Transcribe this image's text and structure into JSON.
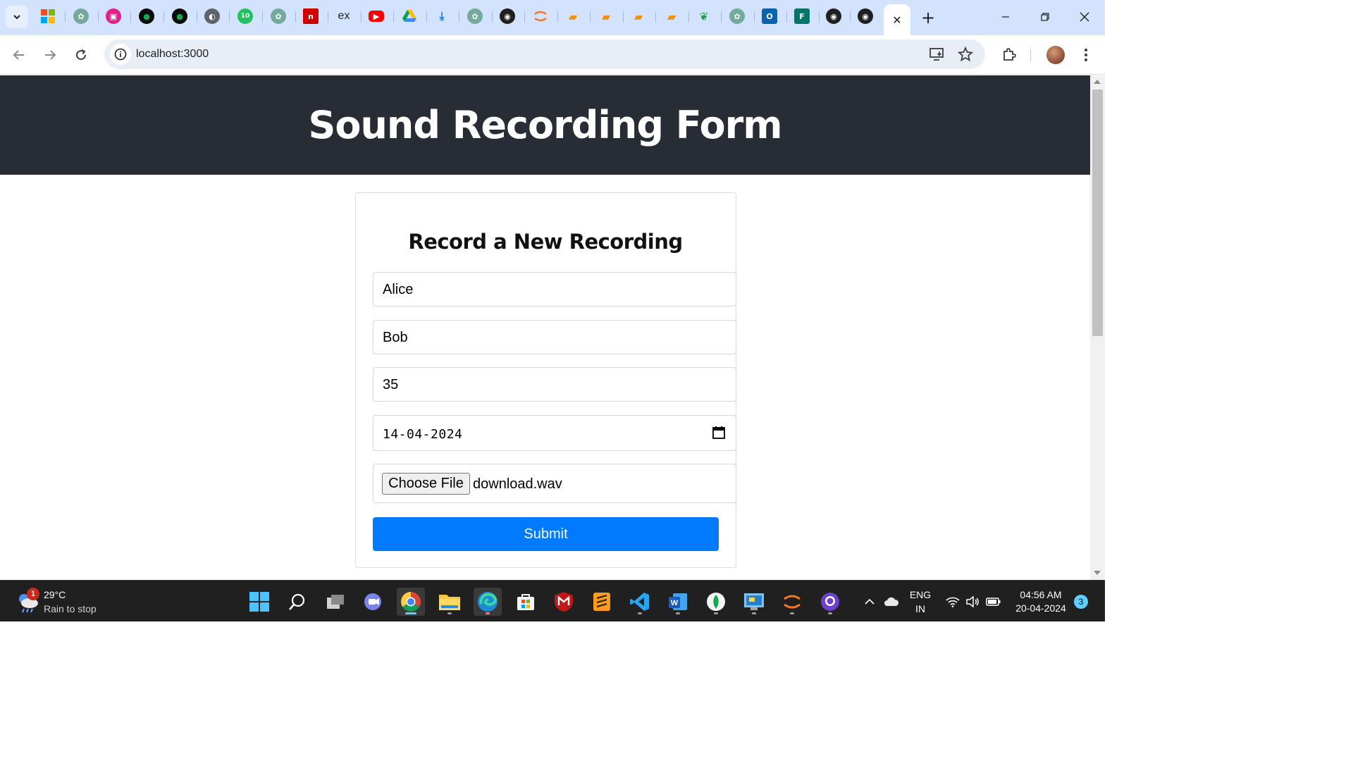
{
  "browser": {
    "tabs": [
      {
        "icon": "microsoft-icon"
      },
      {
        "icon": "chatgpt-icon"
      },
      {
        "icon": "app-icon-pink"
      },
      {
        "icon": "mongodb-icon"
      },
      {
        "icon": "mongodb-icon"
      },
      {
        "icon": "globe-icon"
      },
      {
        "icon": "ten-icon"
      },
      {
        "icon": "chatgpt-icon"
      },
      {
        "icon": "n-icon"
      },
      {
        "icon": "ex-icon"
      },
      {
        "icon": "youtube-icon"
      },
      {
        "icon": "google-drive-icon"
      },
      {
        "icon": "download-icon"
      },
      {
        "icon": "chatgpt-icon"
      },
      {
        "icon": "github-icon"
      },
      {
        "icon": "jupyter-icon"
      },
      {
        "icon": "book-icon"
      },
      {
        "icon": "book-icon"
      },
      {
        "icon": "book-icon"
      },
      {
        "icon": "book-icon"
      },
      {
        "icon": "leaf-icon"
      },
      {
        "icon": "chatgpt-icon"
      },
      {
        "icon": "outlook-icon"
      },
      {
        "icon": "forms-icon"
      },
      {
        "icon": "github-icon"
      },
      {
        "icon": "github-icon"
      }
    ],
    "active_tab_close": "✕",
    "new_tab": "+",
    "url": "localhost:3000"
  },
  "page": {
    "title": "Sound Recording Form",
    "card_title": "Record a New Recording",
    "fields": {
      "name1": "Alice",
      "name2": "Bob",
      "age": "35",
      "date": "14-04-2024",
      "file_button": "Choose File",
      "file_name": "download.wav"
    },
    "submit_label": "Submit"
  },
  "taskbar": {
    "weather_badge": "1",
    "weather_temp": "29°C",
    "weather_desc": "Rain to stop",
    "lang_top": "ENG",
    "lang_bottom": "IN",
    "time": "04:56 AM",
    "date": "20-04-2024",
    "notifications": "3"
  },
  "colors": {
    "header_bg": "#282c34",
    "submit_bg": "#007bff",
    "tabstrip_bg": "#d3e3fd"
  }
}
